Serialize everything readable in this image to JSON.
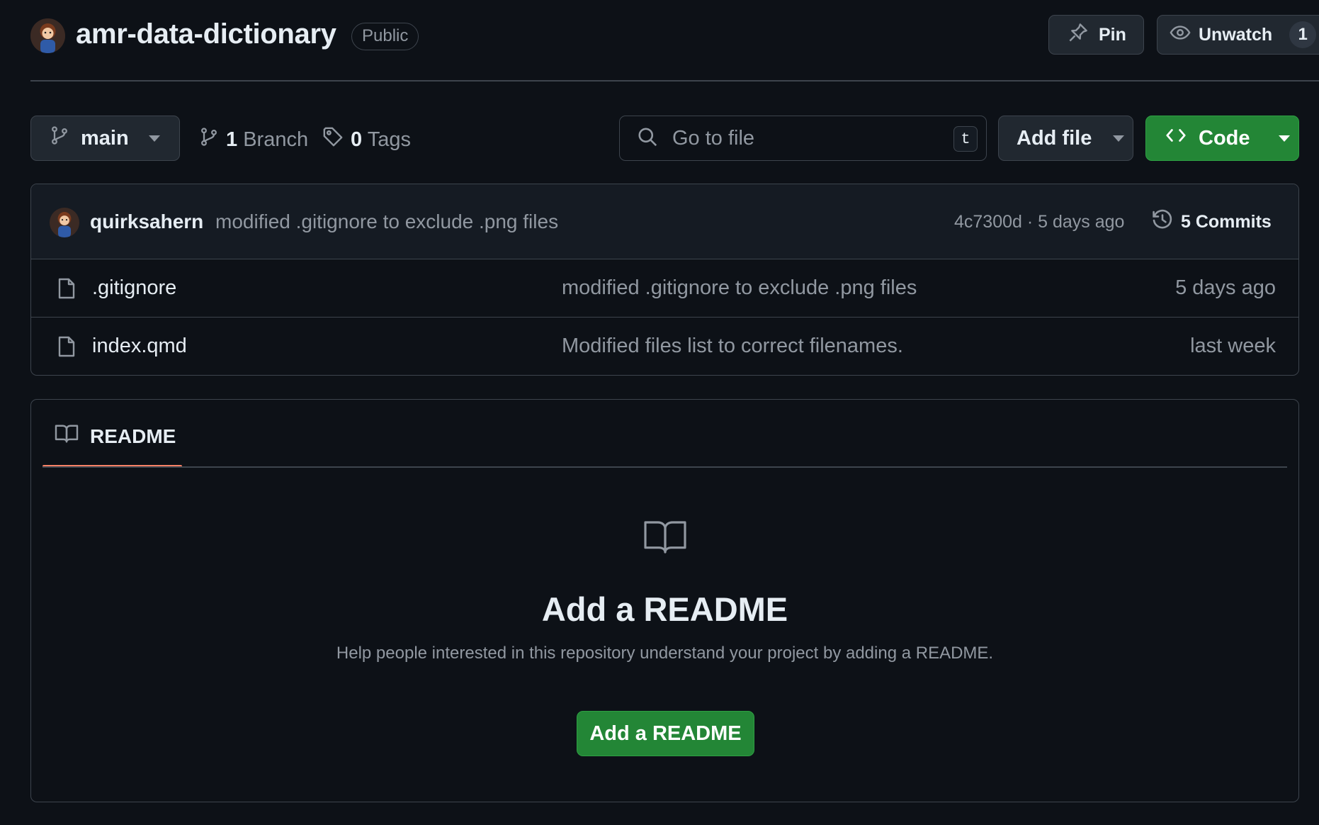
{
  "repo": {
    "name": "amr-data-dictionary",
    "visibility": "Public"
  },
  "actions": {
    "pin_label": "Pin",
    "watch_label": "Unwatch",
    "watch_count": "1"
  },
  "toolbar": {
    "branch": "main",
    "branch_count": "1",
    "branch_label": "Branch",
    "tag_count": "0",
    "tag_label": "Tags",
    "search_placeholder": "Go to file",
    "search_shortcut": "t",
    "add_file_label": "Add file",
    "code_label": "Code"
  },
  "latest_commit": {
    "author": "quirksahern",
    "message": "modified .gitignore to exclude .png files",
    "meta": "4c7300d · 5 days ago",
    "commits_label": "5 Commits"
  },
  "files": [
    {
      "name": ".gitignore",
      "message": "modified .gitignore to exclude .png files",
      "date": "5 days ago"
    },
    {
      "name": "index.qmd",
      "message": "Modified files list to correct filenames.",
      "date": "last week"
    }
  ],
  "readme": {
    "tab_label": "README",
    "heading": "Add a README",
    "description": "Help people interested in this repository understand your project by adding a README.",
    "button_label": "Add a README"
  },
  "colors": {
    "background": "#0d1117",
    "accent_green": "#238636",
    "tab_underline": "#f78166",
    "muted_text": "#9198a1"
  },
  "icons": {
    "branch": "git-branch-icon",
    "tag": "tag-icon",
    "search": "search-icon",
    "code": "code-icon",
    "history": "history-icon",
    "file": "file-icon",
    "book": "book-icon",
    "pin": "pin-icon",
    "eye": "eye-icon"
  }
}
